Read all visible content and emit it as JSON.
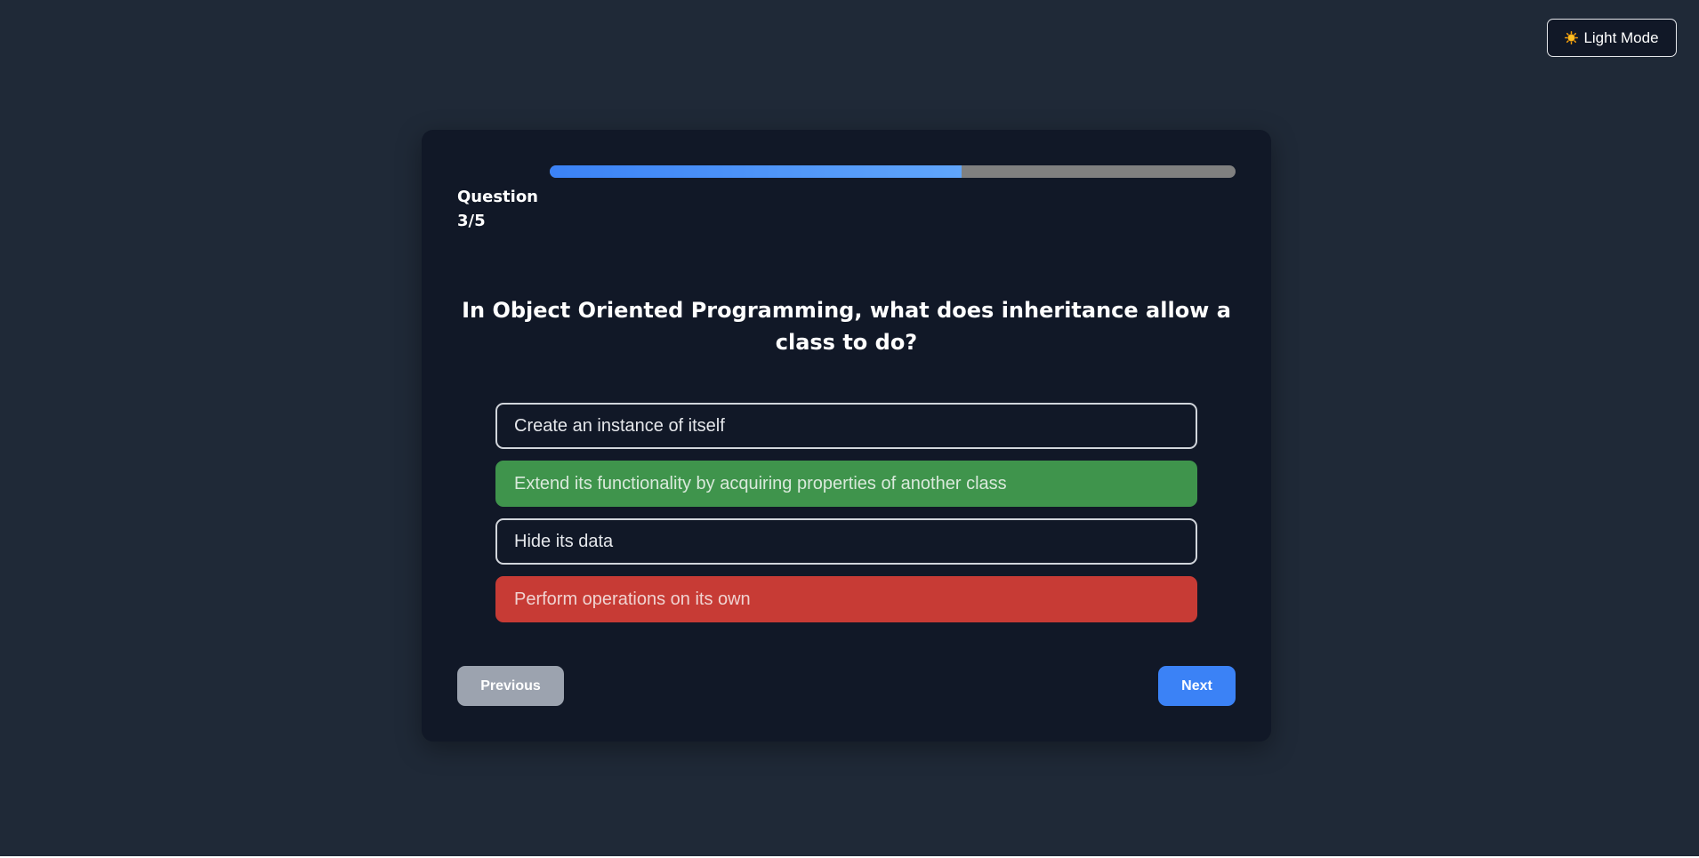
{
  "theme_toggle": {
    "label": "Light Mode",
    "icon": "sun-icon"
  },
  "quiz": {
    "question_count_label": "Question",
    "question_count_value": "3/5",
    "progress": 0.6,
    "question": "In Object Oriented Programming, what does inheritance allow a class to do?",
    "options": [
      {
        "label": "Create an instance of itself",
        "state": "default"
      },
      {
        "label": "Extend its functionality by acquiring properties of another class",
        "state": "correct"
      },
      {
        "label": "Hide its data",
        "state": "default"
      },
      {
        "label": "Perform operations on its own",
        "state": "wrong"
      }
    ],
    "previous_label": "Previous",
    "next_label": "Next"
  },
  "colors": {
    "page_background": "#1f2937",
    "card_background": "#111827",
    "correct": "#3f944c",
    "wrong": "#c73b35",
    "accent": "#3b82f6",
    "previous_button": "#9ca3af",
    "progress_track": "#808080"
  }
}
